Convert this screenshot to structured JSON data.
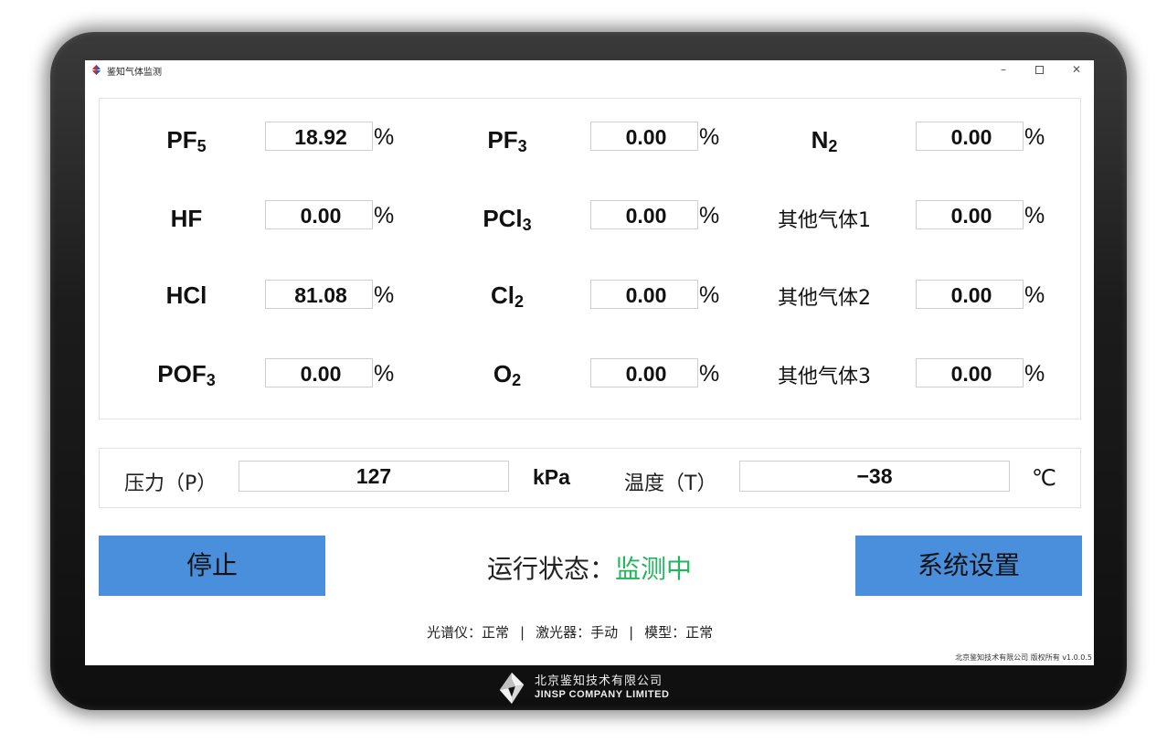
{
  "window": {
    "title": "鉴知气体监测",
    "minimize_glyph": "–",
    "close_glyph": "✕"
  },
  "gases": [
    {
      "name": "PF",
      "sub": "5",
      "value": "18.92",
      "unit": "%"
    },
    {
      "name": "PF",
      "sub": "3",
      "value": "0.00",
      "unit": "%"
    },
    {
      "name": "N",
      "sub": "2",
      "value": "0.00",
      "unit": "%"
    },
    {
      "name": "HF",
      "sub": "",
      "value": "0.00",
      "unit": "%"
    },
    {
      "name": "PCl",
      "sub": "3",
      "value": "0.00",
      "unit": "%"
    },
    {
      "name": "其他气体1",
      "sub": "",
      "value": "0.00",
      "unit": "%"
    },
    {
      "name": "HCl",
      "sub": "",
      "value": "81.08",
      "unit": "%"
    },
    {
      "name": "Cl",
      "sub": "2",
      "value": "0.00",
      "unit": "%"
    },
    {
      "name": "其他气体2",
      "sub": "",
      "value": "0.00",
      "unit": "%"
    },
    {
      "name": "POF",
      "sub": "3",
      "value": "0.00",
      "unit": "%"
    },
    {
      "name": "O",
      "sub": "2",
      "value": "0.00",
      "unit": "%"
    },
    {
      "name": "其他气体3",
      "sub": "",
      "value": "0.00",
      "unit": "%"
    }
  ],
  "pressure": {
    "label": "压力（P）",
    "value": "127",
    "unit": "kPa"
  },
  "temperature": {
    "label": "温度（T）",
    "value": "−38",
    "unit": "℃"
  },
  "controls": {
    "stop_label": "停止",
    "settings_label": "系统设置",
    "status_label": "运行状态：",
    "status_value": "监测中",
    "status_color": "#1fb75a",
    "button_color": "#4a8fdc"
  },
  "device_status": {
    "spectrometer": "光谱仪：正常",
    "laser": "激光器：手动",
    "model": "模型：正常",
    "separator": "|"
  },
  "copyright": "北京鉴知技术有限公司 版权所有 v1.0.0.5",
  "company": {
    "name_cn": "北京鉴知技术有限公司",
    "name_en": "JINSP COMPANY LIMITED"
  }
}
